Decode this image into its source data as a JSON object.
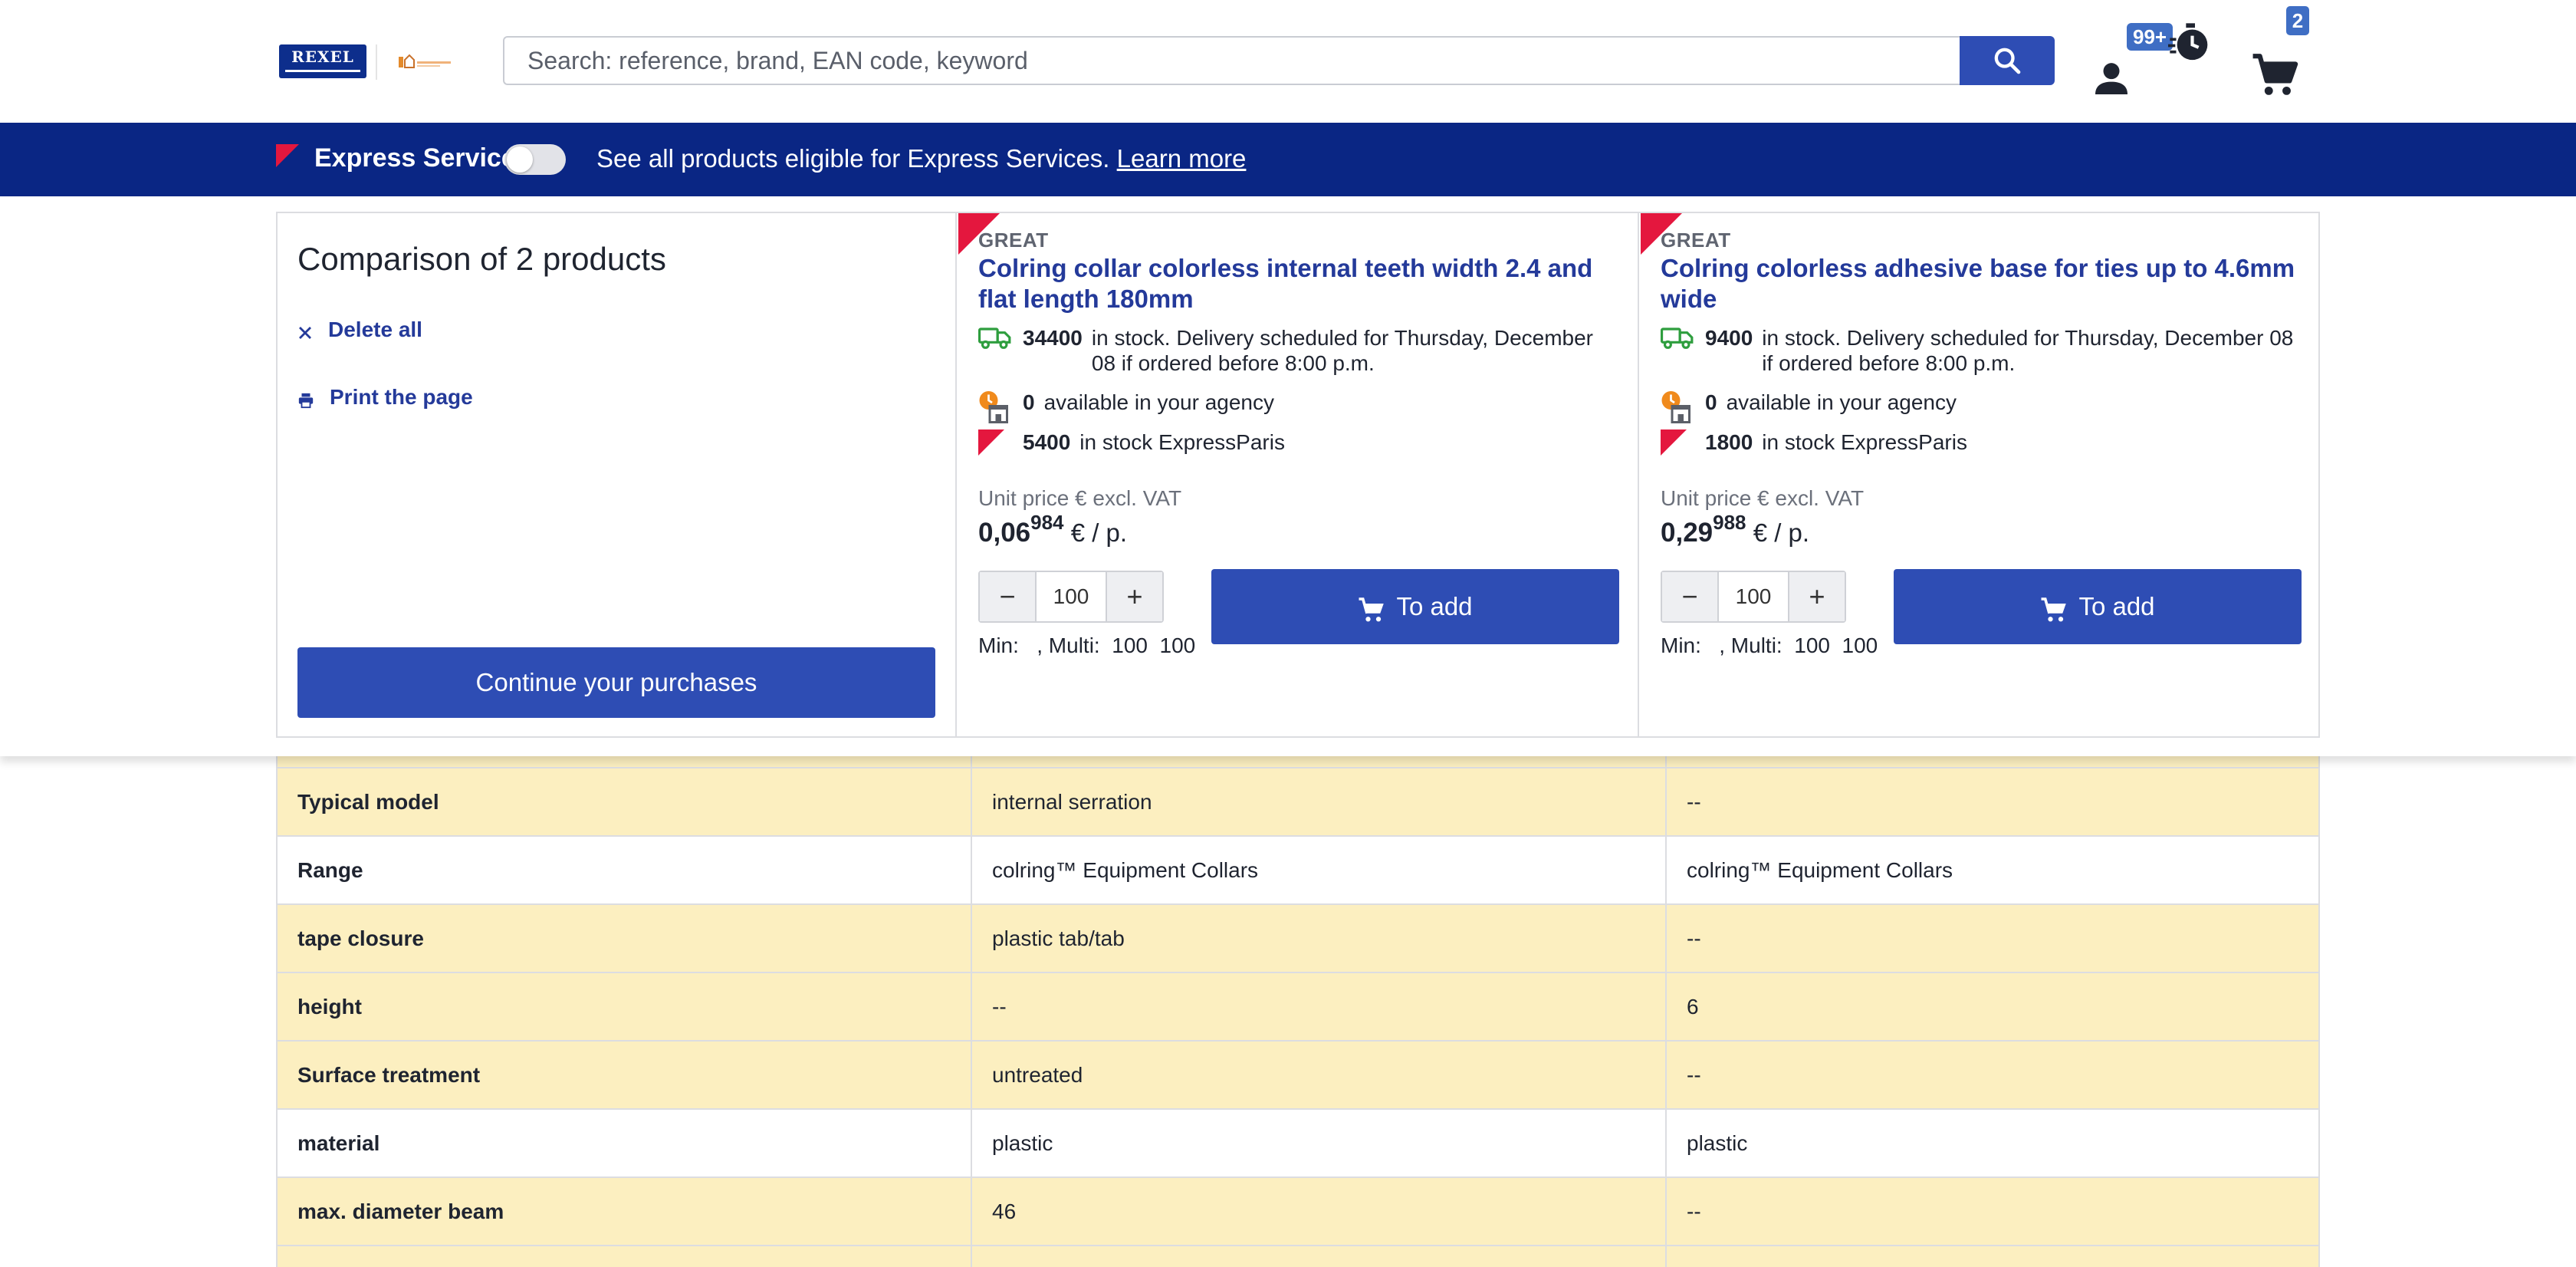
{
  "header": {
    "logo_text": "REXEL",
    "search_placeholder": "Search: reference, brand, EAN code, keyword",
    "timer_badge": "99+",
    "cart_badge": "2"
  },
  "express": {
    "label": "Express Service",
    "toggle_on": false,
    "text": "See all products eligible for Express Services.",
    "link": "Learn more"
  },
  "compare": {
    "title": "Comparison of 2 products",
    "delete_all": "Delete all",
    "print": "Print the page",
    "continue": "Continue your purchases",
    "products": [
      {
        "label": "GREAT",
        "name": "Colring collar colorless internal teeth width 2.4 and flat length 180mm",
        "delivery_qty": "34400",
        "delivery_text": "in stock. Delivery scheduled for Thursday, December 08 if ordered before 8:00 p.m.",
        "agency_qty": "0",
        "agency_text": "available in your agency",
        "express_qty": "5400",
        "express_text": "in stock ExpressParis",
        "unit_label": "Unit price € excl. VAT",
        "price_int": "0,06",
        "price_dec": "984",
        "price_suffix": "€ / p.",
        "quantity": "100",
        "add_label": "To add",
        "min_multi": "Min:   , Multi:  100  100"
      },
      {
        "label": "GREAT",
        "name": "Colring colorless adhesive base for ties up to 4.6mm wide",
        "delivery_qty": "9400",
        "delivery_text": "in stock. Delivery scheduled for Thursday, December 08 if ordered before 8:00 p.m.",
        "agency_qty": "0",
        "agency_text": "available in your agency",
        "express_qty": "1800",
        "express_text": "in stock ExpressParis",
        "unit_label": "Unit price € excl. VAT",
        "price_int": "0,29",
        "price_dec": "988",
        "price_suffix": "€ / p.",
        "quantity": "100",
        "add_label": "To add",
        "min_multi": "Min:   , Multi:  100  100"
      }
    ]
  },
  "specs": [
    {
      "key": "Typical model",
      "p1": "internal serration",
      "p2": "--",
      "highlight": true
    },
    {
      "key": "Range",
      "p1": "colring™ Equipment Collars",
      "p2": "colring™ Equipment Collars",
      "highlight": false
    },
    {
      "key": "tape closure",
      "p1": "plastic tab/tab",
      "p2": "--",
      "highlight": true
    },
    {
      "key": "height",
      "p1": "--",
      "p2": "6",
      "highlight": true
    },
    {
      "key": "Surface treatment",
      "p1": "untreated",
      "p2": "--",
      "highlight": true
    },
    {
      "key": "material",
      "p1": "plastic",
      "p2": "plastic",
      "highlight": false
    },
    {
      "key": "max. diameter beam",
      "p1": "46",
      "p2": "--",
      "highlight": true
    }
  ],
  "colors": {
    "brand_blue": "#2e4db4",
    "express_bar": "#0a2684",
    "highlight_row": "#fcefc0",
    "flag_red": "#e4173e",
    "truck_green": "#2e9e3e",
    "clock_orange": "#f08a1c"
  },
  "icons": [
    "search-icon",
    "user-icon",
    "timer-icon",
    "cart-icon",
    "close-icon",
    "print-icon",
    "truck-icon",
    "store-clock-icon",
    "express-flag-icon"
  ]
}
